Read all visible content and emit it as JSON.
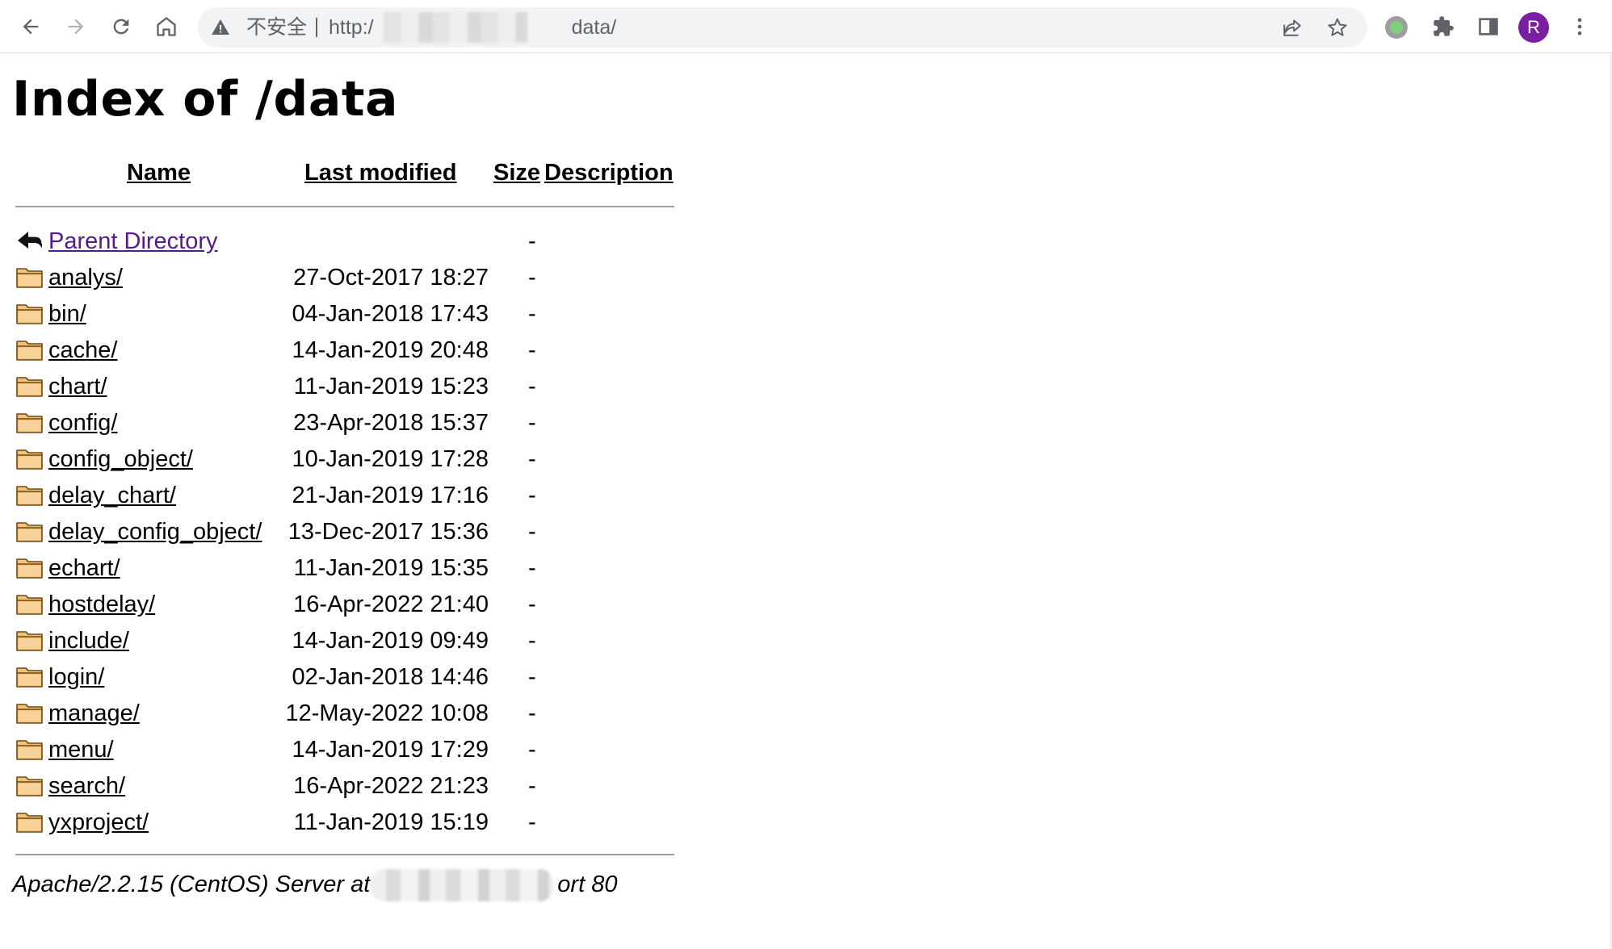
{
  "browser": {
    "security_label": "不安全",
    "url_prefix": "http:/",
    "url_path": "data/",
    "profile_initial": "R"
  },
  "page": {
    "title": "Index of /data",
    "columns": {
      "name": "Name",
      "last_modified": "Last modified",
      "size": "Size",
      "description": "Description"
    },
    "parent": {
      "name": "Parent Directory",
      "size": "-"
    },
    "rows": [
      {
        "name": "analys/",
        "modified": "27-Oct-2017 18:27",
        "size": "-"
      },
      {
        "name": "bin/",
        "modified": "04-Jan-2018 17:43",
        "size": "-"
      },
      {
        "name": "cache/",
        "modified": "14-Jan-2019 20:48",
        "size": "-"
      },
      {
        "name": "chart/",
        "modified": "11-Jan-2019 15:23",
        "size": "-"
      },
      {
        "name": "config/",
        "modified": "23-Apr-2018 15:37",
        "size": "-"
      },
      {
        "name": "config_object/",
        "modified": "10-Jan-2019 17:28",
        "size": "-"
      },
      {
        "name": "delay_chart/",
        "modified": "21-Jan-2019 17:16",
        "size": "-"
      },
      {
        "name": "delay_config_object/",
        "modified": "13-Dec-2017 15:36",
        "size": "-"
      },
      {
        "name": "echart/",
        "modified": "11-Jan-2019 15:35",
        "size": "-"
      },
      {
        "name": "hostdelay/",
        "modified": "16-Apr-2022 21:40",
        "size": "-"
      },
      {
        "name": "include/",
        "modified": "14-Jan-2019 09:49",
        "size": "-"
      },
      {
        "name": "login/",
        "modified": "02-Jan-2018 14:46",
        "size": "-"
      },
      {
        "name": "manage/",
        "modified": "12-May-2022 10:08",
        "size": "-"
      },
      {
        "name": "menu/",
        "modified": "14-Jan-2019 17:29",
        "size": "-"
      },
      {
        "name": "search/",
        "modified": "16-Apr-2022 21:23",
        "size": "-"
      },
      {
        "name": "yxproject/",
        "modified": "11-Jan-2019 15:19",
        "size": "-"
      }
    ],
    "footer_prefix": "Apache/2.2.15 (CentOS) Server at",
    "footer_suffix": "ort 80"
  },
  "colors": {
    "link": "#0000ee",
    "visited_link": "#551a8b",
    "folder_fill": "#f2c27a",
    "folder_stroke": "#6b4a12",
    "avatar": "#7b1fa2"
  },
  "icons": {
    "nav": [
      "back-arrow-icon",
      "forward-arrow-icon",
      "reload-icon",
      "home-icon"
    ],
    "omnibox": [
      "warning-icon",
      "share-icon",
      "star-icon"
    ],
    "toolbar": [
      "extension-status-icon",
      "puzzle-icon",
      "side-panel-icon",
      "kebab-menu-icon"
    ],
    "listing": [
      "back-folder-icon",
      "folder-icon"
    ]
  }
}
